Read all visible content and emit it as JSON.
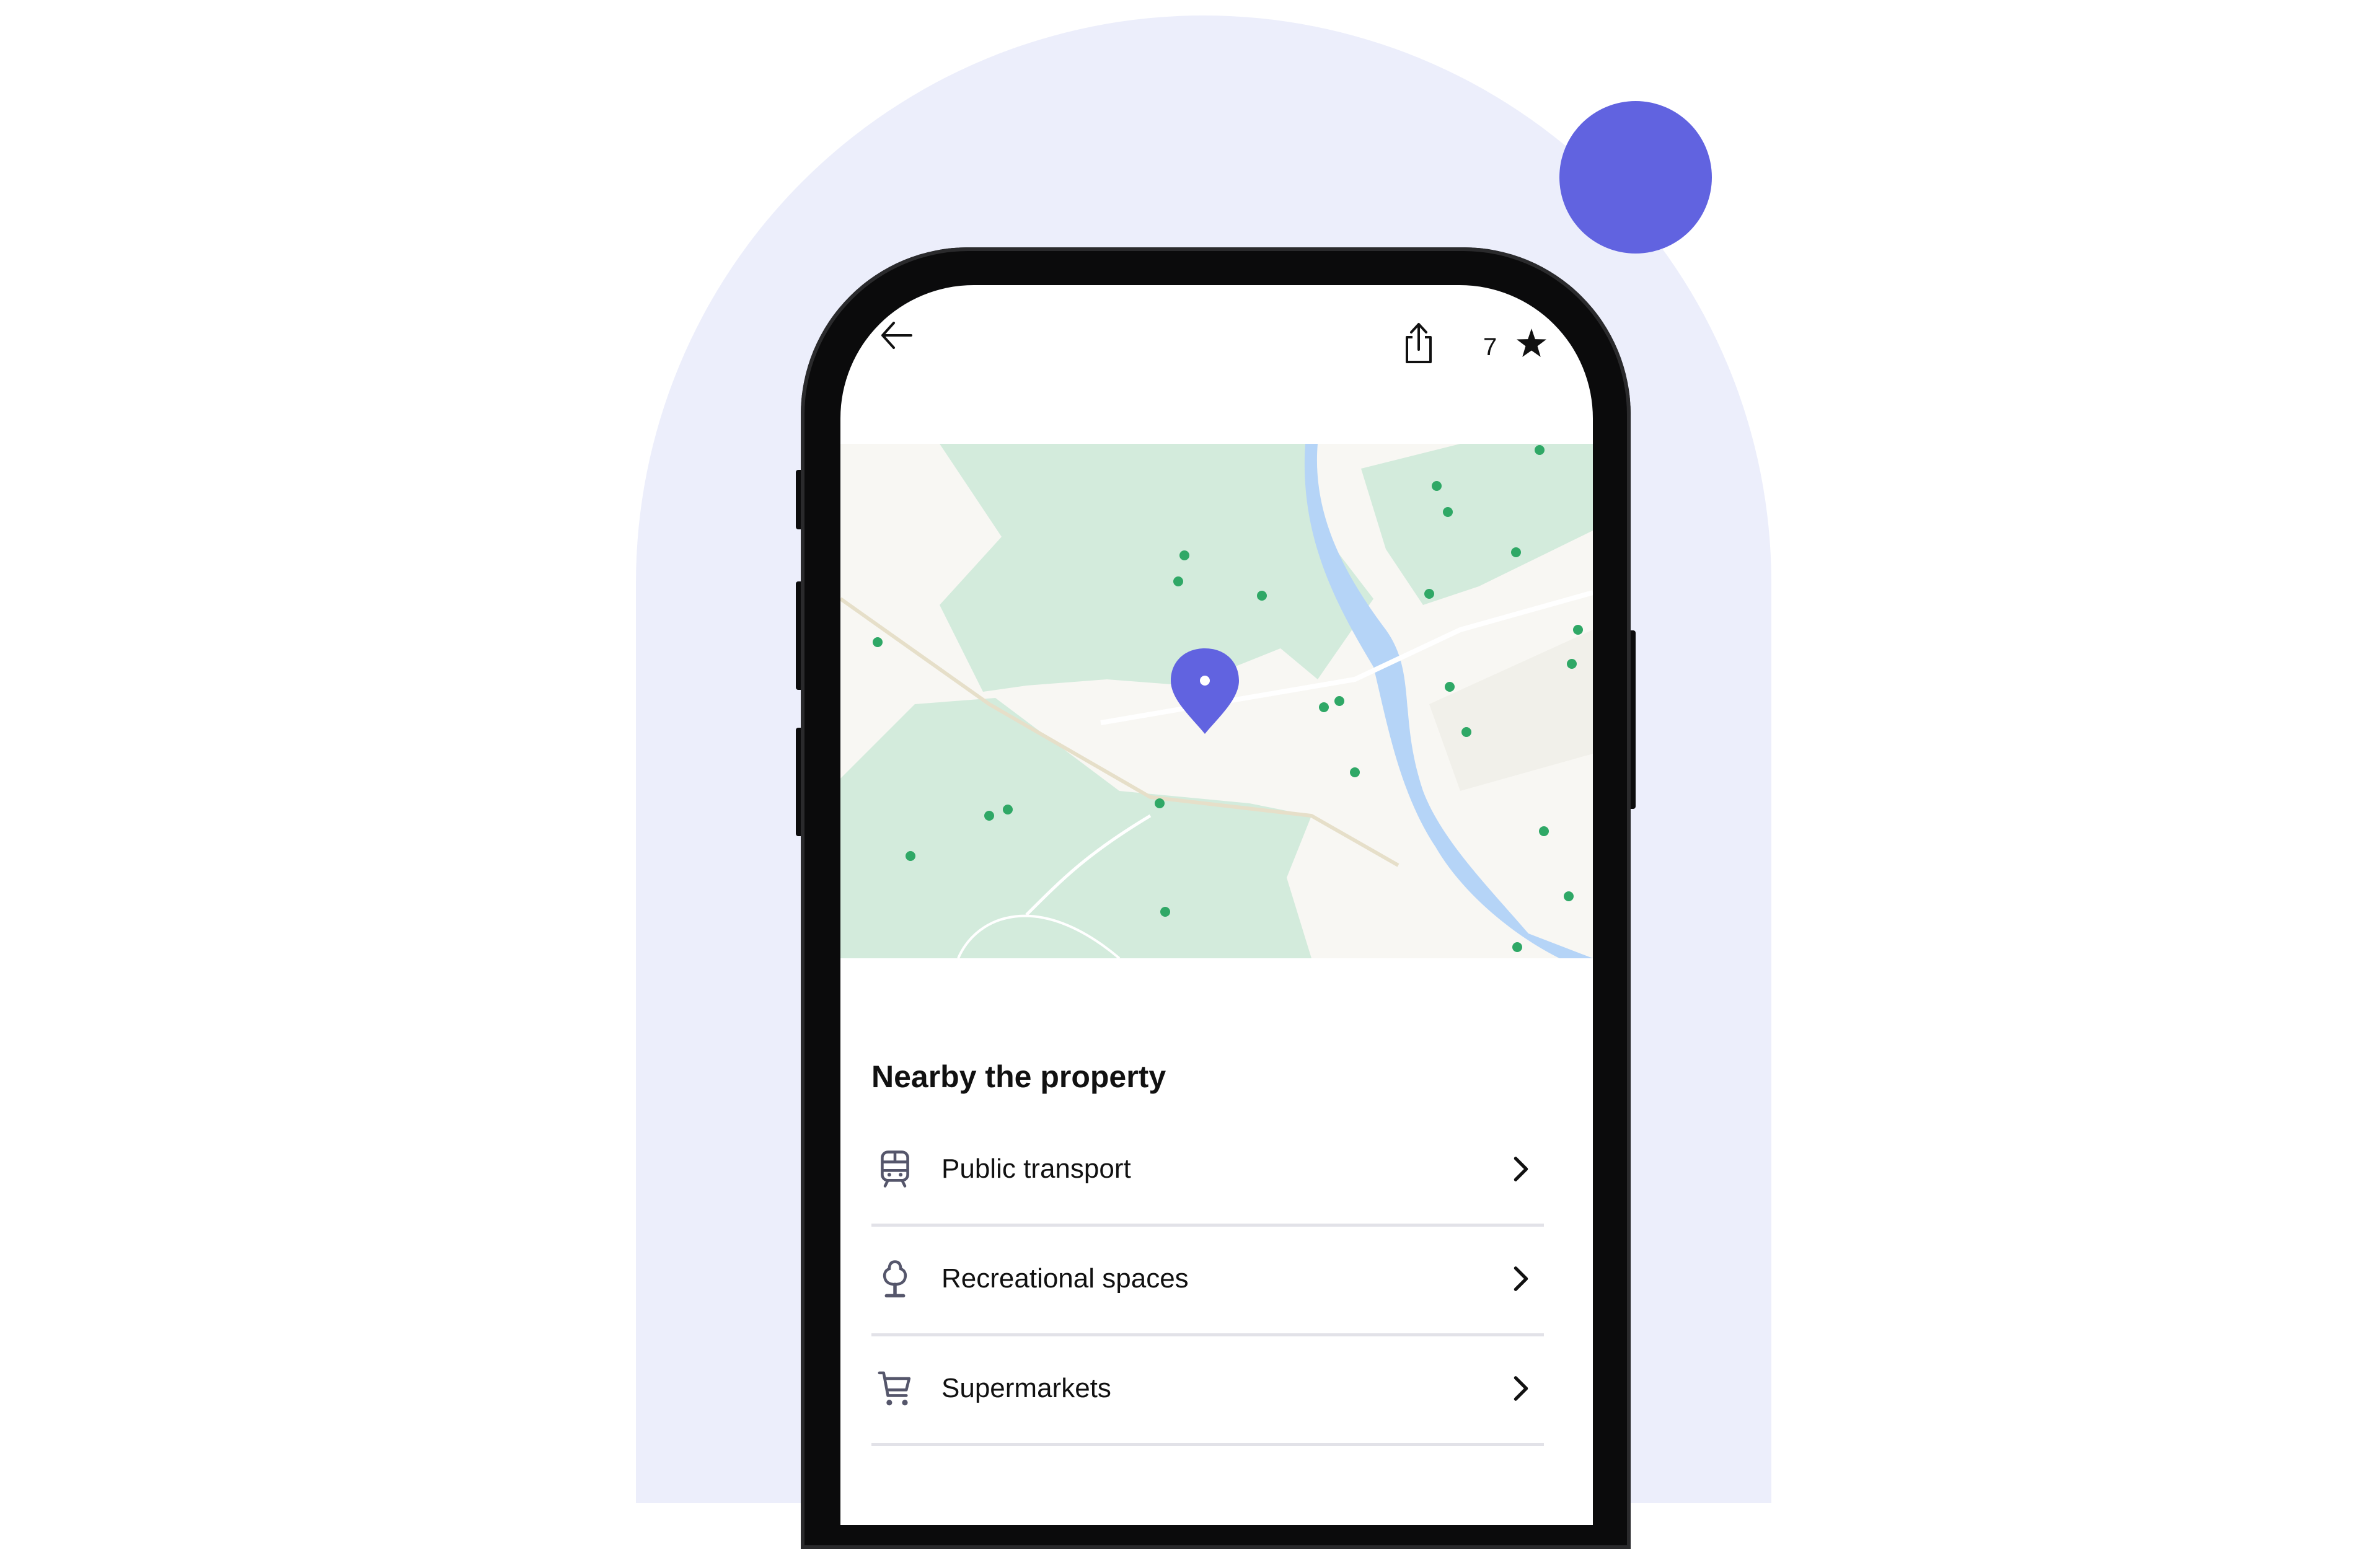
{
  "colors": {
    "accent": "#6163e0",
    "background_shape": "#eceefb",
    "pin_green": "#2fa866",
    "map_green": "#d3ebdc",
    "water": "#b5d4f7"
  },
  "header": {
    "back_icon": "arrow-left-icon",
    "share_icon": "share-icon",
    "favorites_count": "7",
    "star_icon": "star-icon"
  },
  "map": {
    "location_pin_icon": "map-pin-icon"
  },
  "nearby": {
    "title": "Nearby the property",
    "items": [
      {
        "label": "Public transport",
        "icon": "train-icon"
      },
      {
        "label": "Recreational spaces",
        "icon": "tree-icon"
      },
      {
        "label": "Supermarkets",
        "icon": "cart-icon"
      }
    ]
  }
}
